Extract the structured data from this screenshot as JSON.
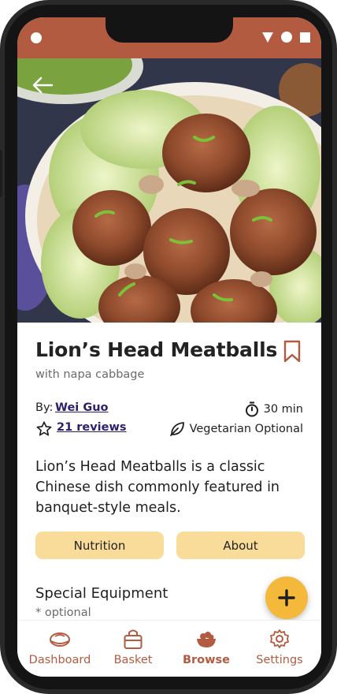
{
  "recipe": {
    "title": "Lion’s Head Meatballs",
    "subtitle": "with napa cabbage",
    "by_label": "By:",
    "author": "Wei Guo",
    "time": "30 min",
    "reviews": "21 reviews",
    "diet": "Vegetarian Optional",
    "description": "Lion’s Head Meatballs is a classic Chinese dish commonly featured in banquet-style meals."
  },
  "buttons": {
    "nutrition": "Nutrition",
    "about": "About"
  },
  "equipment": {
    "title": "Special Equipment",
    "subtitle": "* optional"
  },
  "nav": {
    "items": [
      {
        "label": "Dashboard",
        "icon": "dashboard-icon",
        "active": false
      },
      {
        "label": "Basket",
        "icon": "basket-icon",
        "active": false
      },
      {
        "label": "Browse",
        "icon": "browse-bowl-icon",
        "active": true
      },
      {
        "label": "Settings",
        "icon": "gear-icon",
        "active": false
      }
    ]
  },
  "colors": {
    "brand": "#b25b40",
    "accent_button": "#f9dc9a",
    "fab": "#f4b93a",
    "link": "#2d1f6b"
  }
}
